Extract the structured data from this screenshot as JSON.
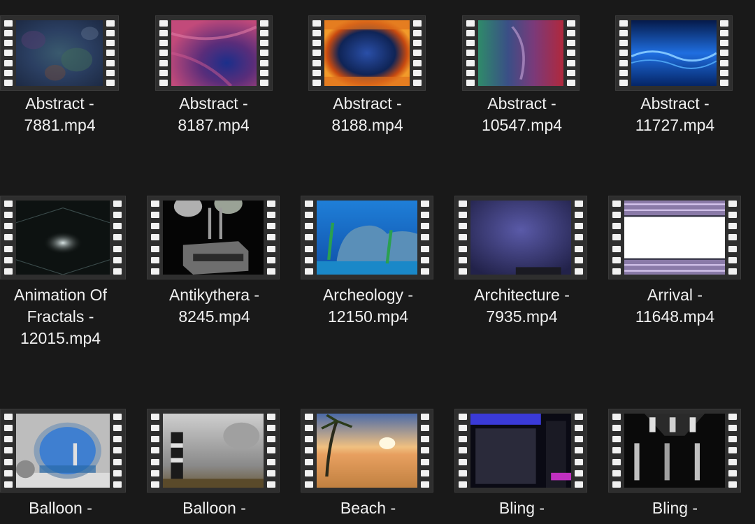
{
  "files": [
    {
      "line1": "Abstract -",
      "line2": "7881.mp4",
      "line3": "",
      "thumb": "abstract-7881-icon"
    },
    {
      "line1": "Abstract -",
      "line2": "8187.mp4",
      "line3": "",
      "thumb": "abstract-8187-icon"
    },
    {
      "line1": "Abstract -",
      "line2": "8188.mp4",
      "line3": "",
      "thumb": "abstract-8188-icon"
    },
    {
      "line1": "Abstract -",
      "line2": "10547.mp4",
      "line3": "",
      "thumb": "abstract-10547-icon"
    },
    {
      "line1": "Abstract -",
      "line2": "11727.mp4",
      "line3": "",
      "thumb": "abstract-11727-icon"
    },
    {
      "line1": "Animation Of",
      "line2": "Fractals -",
      "line3": "12015.mp4",
      "thumb": "fractals-icon"
    },
    {
      "line1": "Antikythera -",
      "line2": "8245.mp4",
      "line3": "",
      "thumb": "antikythera-icon"
    },
    {
      "line1": "Archeology -",
      "line2": "12150.mp4",
      "line3": "",
      "thumb": "archeology-icon"
    },
    {
      "line1": "Architecture -",
      "line2": "7935.mp4",
      "line3": "",
      "thumb": "architecture-icon"
    },
    {
      "line1": "Arrival -",
      "line2": "11648.mp4",
      "line3": "",
      "thumb": "arrival-icon"
    },
    {
      "line1": "Balloon -",
      "line2": "",
      "line3": "",
      "thumb": "balloon-1-icon"
    },
    {
      "line1": "Balloon -",
      "line2": "",
      "line3": "",
      "thumb": "balloon-2-icon"
    },
    {
      "line1": "Beach -",
      "line2": "",
      "line3": "",
      "thumb": "beach-icon"
    },
    {
      "line1": "Bling -",
      "line2": "",
      "line3": "",
      "thumb": "bling-1-icon"
    },
    {
      "line1": "Bling -",
      "line2": "",
      "line3": "",
      "thumb": "bling-2-icon"
    }
  ],
  "colors": {
    "background": "#191919",
    "text": "#f0f0f0",
    "film_frame": "#2e2e2e",
    "sprocket": "#f2f2f2"
  }
}
